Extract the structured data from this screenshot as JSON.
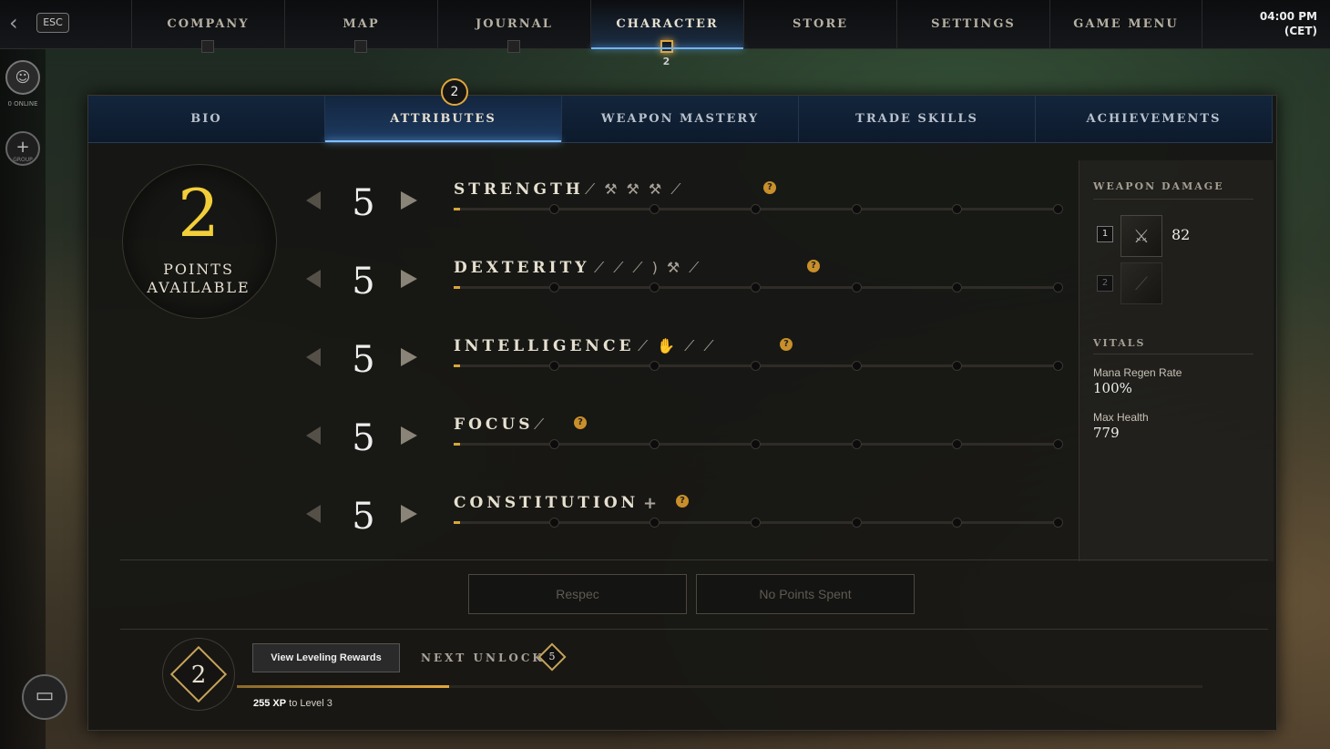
{
  "topbar": {
    "esc_label": "ESC",
    "nav": [
      {
        "label": "COMPANY",
        "active": false
      },
      {
        "label": "MAP",
        "active": false
      },
      {
        "label": "JOURNAL",
        "active": false
      },
      {
        "label": "CHARACTER",
        "active": true,
        "badge": "2"
      },
      {
        "label": "STORE",
        "active": false
      },
      {
        "label": "SETTINGS",
        "active": false
      },
      {
        "label": "GAME MENU",
        "active": false
      }
    ],
    "clock_time": "04:00 PM",
    "clock_zone": "(CET)"
  },
  "rail": {
    "online_label": "0 ONLINE",
    "group_label": "GROUP"
  },
  "subtabs": [
    {
      "label": "BIO",
      "active": false
    },
    {
      "label": "ATTRIBUTES",
      "active": true
    },
    {
      "label": "WEAPON MASTERY",
      "active": false
    },
    {
      "label": "TRADE SKILLS",
      "active": false
    },
    {
      "label": "ACHIEVEMENTS",
      "active": false
    }
  ],
  "attributes_badge": "2",
  "points": {
    "value": "2",
    "label_line1": "POINTS",
    "label_line2": "AVAILABLE"
  },
  "attributes": [
    {
      "name": "STRENGTH",
      "value": "5",
      "weapon_icons": [
        "sword-icon",
        "hatchet-icon",
        "war-hammer-icon",
        "great-axe-icon",
        "spear-icon"
      ],
      "progress": 0.01
    },
    {
      "name": "DEXTERITY",
      "value": "5",
      "weapon_icons": [
        "sword-icon",
        "rapier-icon",
        "spear-icon",
        "bow-icon",
        "musket-icon",
        "hatchet-icon"
      ],
      "progress": 0.01
    },
    {
      "name": "INTELLIGENCE",
      "value": "5",
      "weapon_icons": [
        "fire-staff-icon",
        "ice-gauntlet-icon",
        "rapier-icon",
        "blunderbuss-icon"
      ],
      "progress": 0.01
    },
    {
      "name": "FOCUS",
      "value": "5",
      "weapon_icons": [
        "life-staff-icon"
      ],
      "progress": 0.01
    },
    {
      "name": "CONSTITUTION",
      "value": "5",
      "weapon_icons": [
        "health-plus-icon"
      ],
      "progress": 0.01
    }
  ],
  "weapon_damage": {
    "heading": "WEAPON DAMAGE",
    "slot1_num": "1",
    "slot1_value": "82",
    "slot2_num": "2"
  },
  "vitals": {
    "heading": "VITALS",
    "mana_label": "Mana Regen Rate",
    "mana_value": "100%",
    "health_label": "Max Health",
    "health_value": "779"
  },
  "buttons": {
    "respec": "Respec",
    "no_points": "No Points Spent"
  },
  "leveling": {
    "level": "2",
    "rewards_button": "View Leveling Rewards",
    "next_unlock_label": "NEXT UNLOCK",
    "next_unlock_value": "5",
    "xp_amount": "255 XP",
    "xp_suffix": " to Level 3",
    "xp_progress": 0.22
  },
  "colors": {
    "accent_gold": "#e2a63b",
    "points_yellow": "#f2cf3a",
    "tab_blue": "#7ec0ff"
  }
}
